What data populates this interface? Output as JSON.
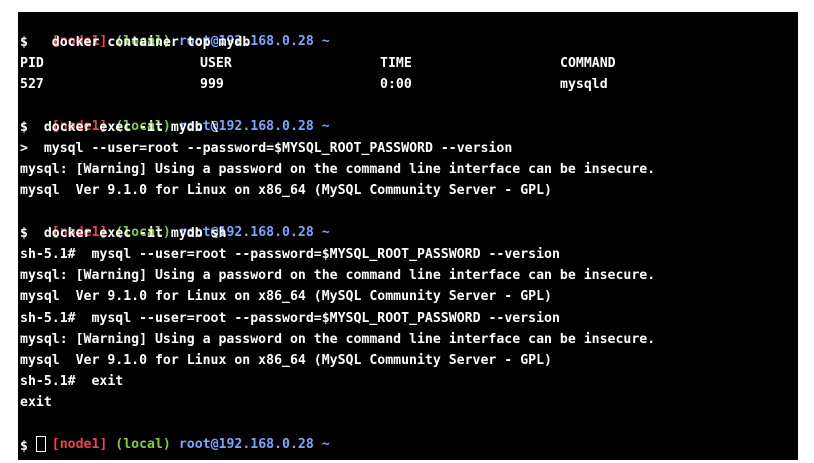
{
  "prompt": {
    "node": "[node1]",
    "local": "(local)",
    "user_host": "root@192.168.0.28",
    "tilde": "~",
    "dollar": "$"
  },
  "commands": {
    "top": "  docker container top mydb",
    "exec_mysql": " docker exec -it mydb \\",
    "exec_mysql_cont_marker": ">",
    "exec_mysql_cont": " mysql --user=root --password=$MYSQL_ROOT_PASSWORD --version",
    "exec_sh": " docker exec -it mydb sh"
  },
  "top_table": {
    "headers": [
      "PID",
      "USER",
      "TIME",
      "COMMAND"
    ],
    "row": [
      "527",
      "999",
      "0:00",
      "mysqld"
    ]
  },
  "output": {
    "warning": "mysql: [Warning] Using a password on the command line interface can be insecure.",
    "version": "mysql  Ver 9.1.0 for Linux on x86_64 (MySQL Community Server - GPL)",
    "exit": "exit"
  },
  "sh": {
    "prompt": "sh-5.1#",
    "mysql_cmd": "mysql --user=root --password=$MYSQL_ROOT_PASSWORD --version",
    "exit_cmd": "exit"
  },
  "colors": {
    "background": "#000000",
    "node": "#e5484d",
    "local": "#7fd13b",
    "user_host": "#7aa6ff",
    "text": "#ffffff"
  }
}
